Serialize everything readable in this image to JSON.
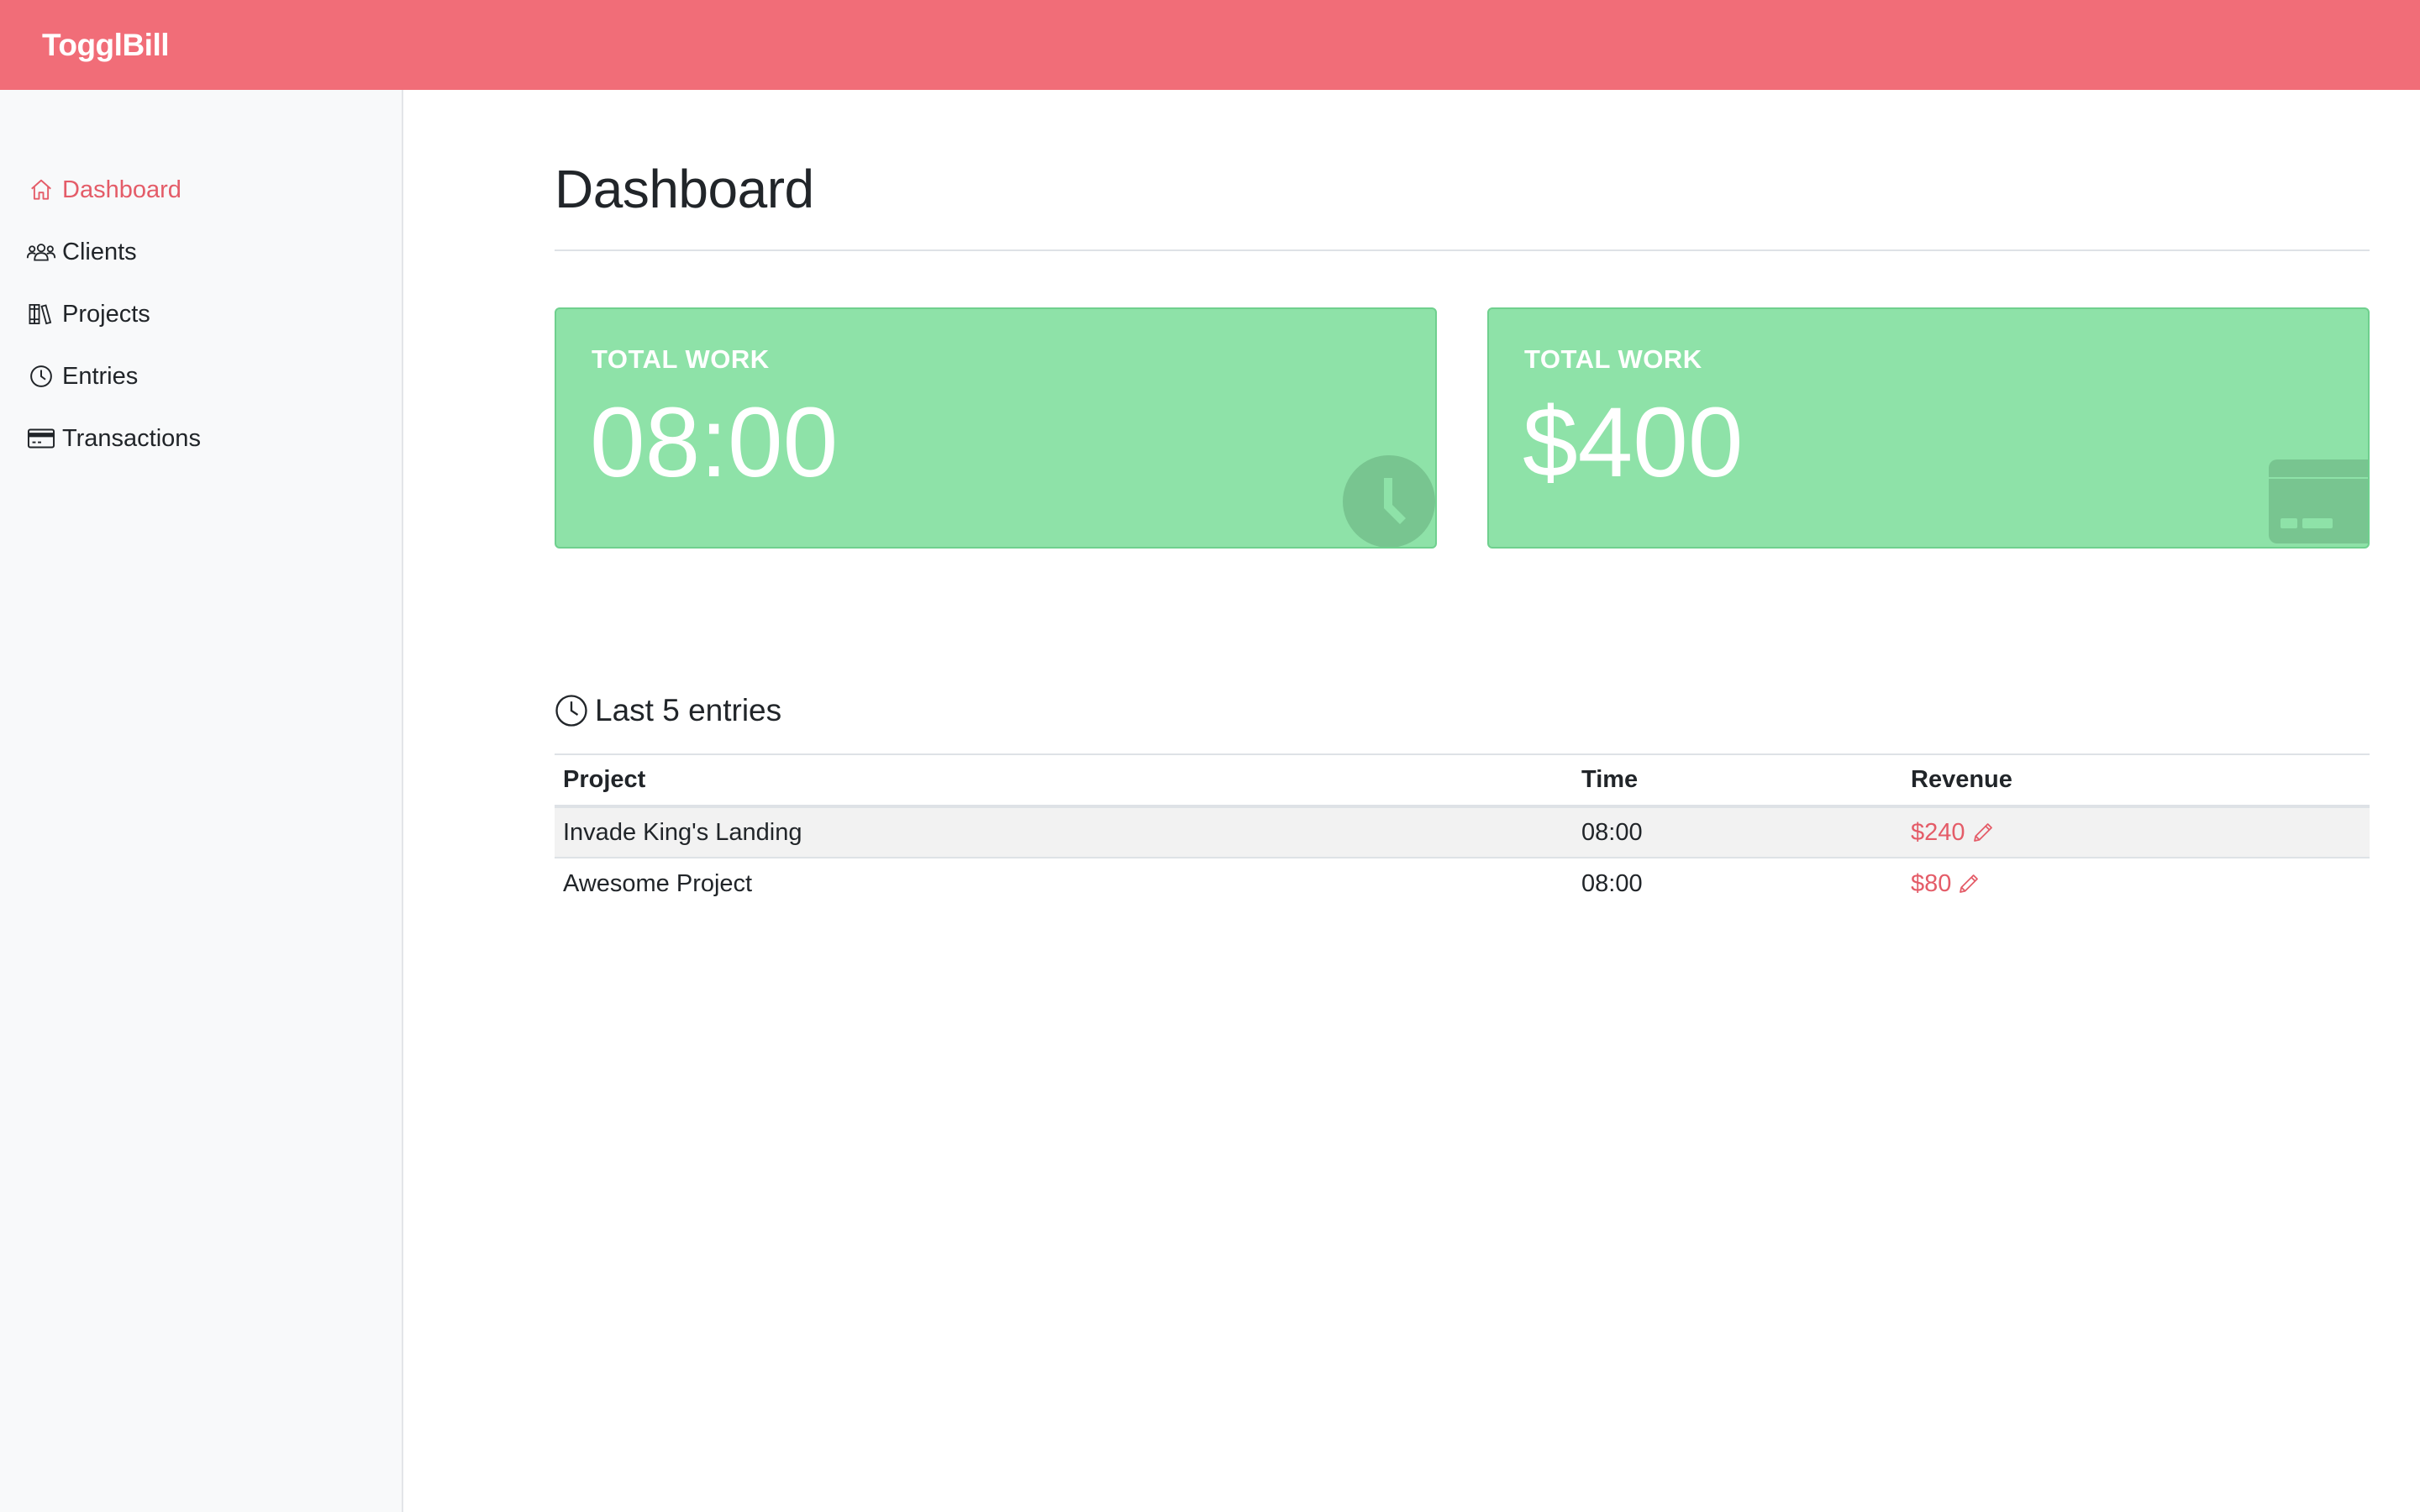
{
  "header": {
    "brand": "TogglBill",
    "accent_color": "#f16d78"
  },
  "sidebar": {
    "items": [
      {
        "label": "Dashboard",
        "icon": "home-icon",
        "active": true
      },
      {
        "label": "Clients",
        "icon": "users-icon",
        "active": false
      },
      {
        "label": "Projects",
        "icon": "library-icon",
        "active": false
      },
      {
        "label": "Entries",
        "icon": "clock-icon",
        "active": false
      },
      {
        "label": "Transactions",
        "icon": "credit-card-icon",
        "active": false
      }
    ]
  },
  "main": {
    "title": "Dashboard",
    "cards": [
      {
        "label": "TOTAL WORK",
        "value": "08:00",
        "icon": "clock-icon",
        "color": "#8ee2a8"
      },
      {
        "label": "TOTAL WORK",
        "value": "$400",
        "icon": "credit-card-icon",
        "color": "#8ee2a8"
      }
    ],
    "entries_heading": "Last 5 entries",
    "table": {
      "columns": [
        "Project",
        "Time",
        "Revenue"
      ],
      "rows": [
        {
          "project": "Invade King's Landing",
          "time": "08:00",
          "revenue": "$240"
        },
        {
          "project": "Awesome Project",
          "time": "08:00",
          "revenue": "$80"
        }
      ]
    }
  }
}
